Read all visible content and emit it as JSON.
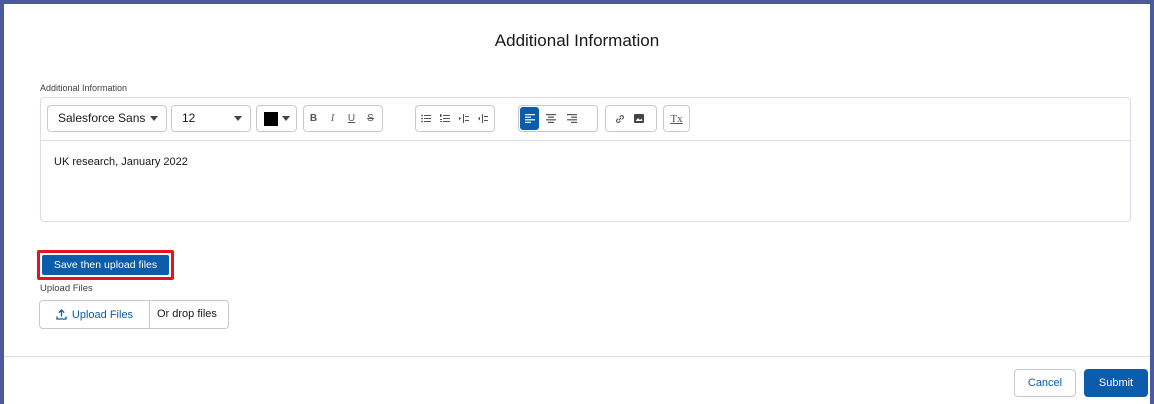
{
  "modal": {
    "title": "Additional Information"
  },
  "editor": {
    "label": "Additional Information",
    "font_family": "Salesforce Sans",
    "font_size": "12",
    "text_color": "#000000",
    "content": "UK research, January 2022",
    "toolbar_buttons": {
      "bold": "B",
      "italic": "I",
      "underline": "U",
      "strikethrough": "S",
      "remove_format": "Tx"
    },
    "active_alignment": "align-left"
  },
  "actions": {
    "save_then_upload_label": "Save then upload files",
    "upload_files_label": "Upload Files",
    "upload_button_label": "Upload Files",
    "drop_text": "Or drop files"
  },
  "footer": {
    "cancel_label": "Cancel",
    "submit_label": "Submit"
  },
  "colors": {
    "brand": "#0b5cab",
    "highlight_border": "#e5121f",
    "frame": "#4a5a9a"
  }
}
